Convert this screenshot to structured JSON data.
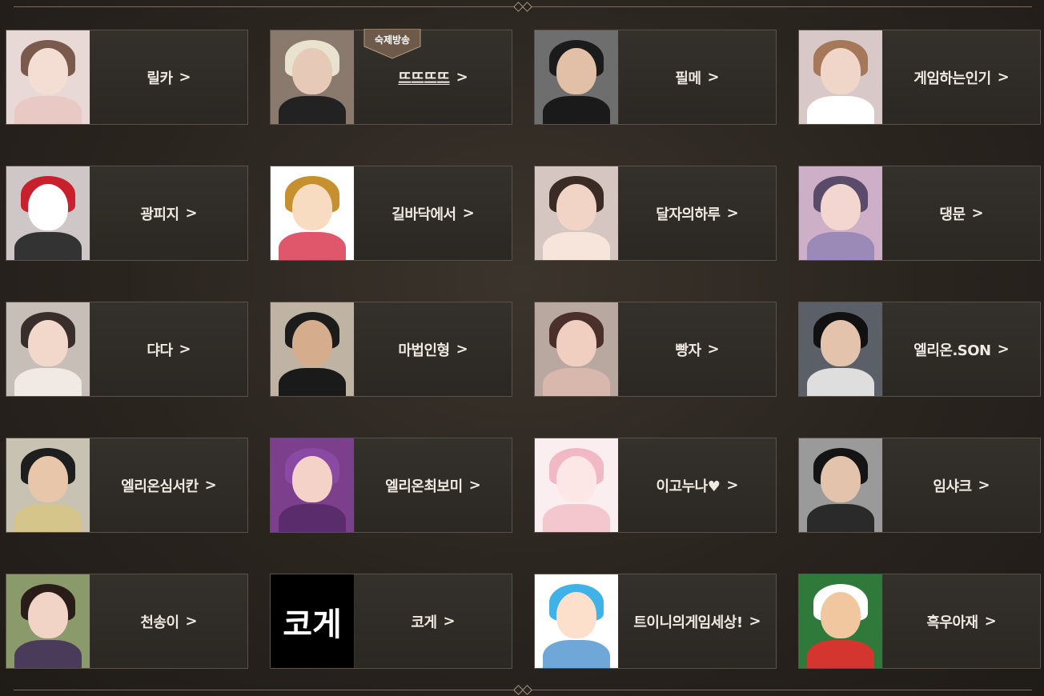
{
  "ornament_colors": {
    "line": "#7a6d5f",
    "diamond": "#a79682"
  },
  "cards": [
    {
      "name": "릴카",
      "chevron": ">",
      "avatar": {
        "bg": "#e8d8d6",
        "hair": "#7a5a4c",
        "face": "#f4ddd3",
        "body": "#e9c9c4"
      }
    },
    {
      "name": "뜨뜨뜨뜨",
      "chevron": ">",
      "underline": true,
      "badge": "숙제방송",
      "avatar": {
        "bg": "#8a7a6e",
        "hair": "#e9e2cf",
        "face": "#e6c9b7",
        "body": "#222222"
      }
    },
    {
      "name": "필메",
      "chevron": ">",
      "avatar": {
        "bg": "#6e6e6e",
        "hair": "#1b1b1b",
        "face": "#e2c0a7",
        "body": "#1a1a1a"
      }
    },
    {
      "name": "게임하는인기",
      "chevron": ">",
      "avatar": {
        "bg": "#d9c8c8",
        "hair": "#a5785a",
        "face": "#f0d6c8",
        "body": "#ffffff"
      }
    },
    {
      "name": "광피지",
      "chevron": ">",
      "avatar": {
        "bg": "#cfc7c7",
        "hair": "#c8202c",
        "face": "#ffffff",
        "body": "#333333"
      }
    },
    {
      "name": "길바닥에서",
      "chevron": ">",
      "avatar": {
        "bg": "#ffffff",
        "hair": "#c6902f",
        "face": "#f7dcc2",
        "body": "#e0566a"
      }
    },
    {
      "name": "달자의하루",
      "chevron": ">",
      "avatar": {
        "bg": "#d6c6c2",
        "hair": "#3a2c25",
        "face": "#f1d4c5",
        "body": "#f7e5dc"
      }
    },
    {
      "name": "댕문",
      "chevron": ">",
      "avatar": {
        "bg": "#cdb0c8",
        "hair": "#5a4b6a",
        "face": "#f3d6cf",
        "body": "#9b89b8"
      }
    },
    {
      "name": "댜다",
      "chevron": ">",
      "avatar": {
        "bg": "#c7bfb7",
        "hair": "#3a2e2a",
        "face": "#f2d8cb",
        "body": "#f1e9e4"
      }
    },
    {
      "name": "마법인형",
      "chevron": ">",
      "avatar": {
        "bg": "#bfb3a3",
        "hair": "#1c1c1c",
        "face": "#d6ad8c",
        "body": "#1a1a1a"
      }
    },
    {
      "name": "빵자",
      "chevron": ">",
      "avatar": {
        "bg": "#b8a8a0",
        "hair": "#4a2f2a",
        "face": "#f0cfc1",
        "body": "#d8b7ad"
      }
    },
    {
      "name": "엘리온.SON",
      "chevron": ">",
      "avatar": {
        "bg": "#5a5f68",
        "hair": "#111111",
        "face": "#e4c3ad",
        "body": "#dedede"
      }
    },
    {
      "name": "엘리온심서칸",
      "chevron": ">",
      "avatar": {
        "bg": "#c8c2b2",
        "hair": "#1e1e1e",
        "face": "#e7c6a9",
        "body": "#d6c58a"
      }
    },
    {
      "name": "엘리온최보미",
      "chevron": ">",
      "avatar": {
        "bg": "#7b3f8b",
        "hair": "#8a4aa4",
        "face": "#f4d2c8",
        "body": "#5b2c6b"
      }
    },
    {
      "name": "이고누나♥",
      "chevron": ">",
      "avatar": {
        "bg": "#fbeef0",
        "hair": "#f0b9c4",
        "face": "#fde6e6",
        "body": "#f4c7cf"
      }
    },
    {
      "name": "임샤크",
      "chevron": ">",
      "avatar": {
        "bg": "#9a9a9a",
        "hair": "#141414",
        "face": "#e3c3ab",
        "body": "#2a2a2a"
      }
    },
    {
      "name": "천송이",
      "chevron": ">",
      "avatar": {
        "bg": "#8a9a6a",
        "hair": "#2a1d18",
        "face": "#f2d4c7",
        "body": "#4a3b5a"
      }
    },
    {
      "name": "코게",
      "chevron": ">",
      "avatar": {
        "bg": "#000000",
        "text": "코게"
      }
    },
    {
      "name": "트이니의게임세상!",
      "chevron": ">",
      "avatar": {
        "bg": "#ffffff",
        "hair": "#3fb2e8",
        "face": "#fde0cc",
        "body": "#6ea7d8"
      }
    },
    {
      "name": "흑우아재",
      "chevron": ">",
      "avatar": {
        "bg": "#2f7a3a",
        "hair": "#ffffff",
        "face": "#f1c7a0",
        "body": "#d4352f"
      }
    }
  ]
}
